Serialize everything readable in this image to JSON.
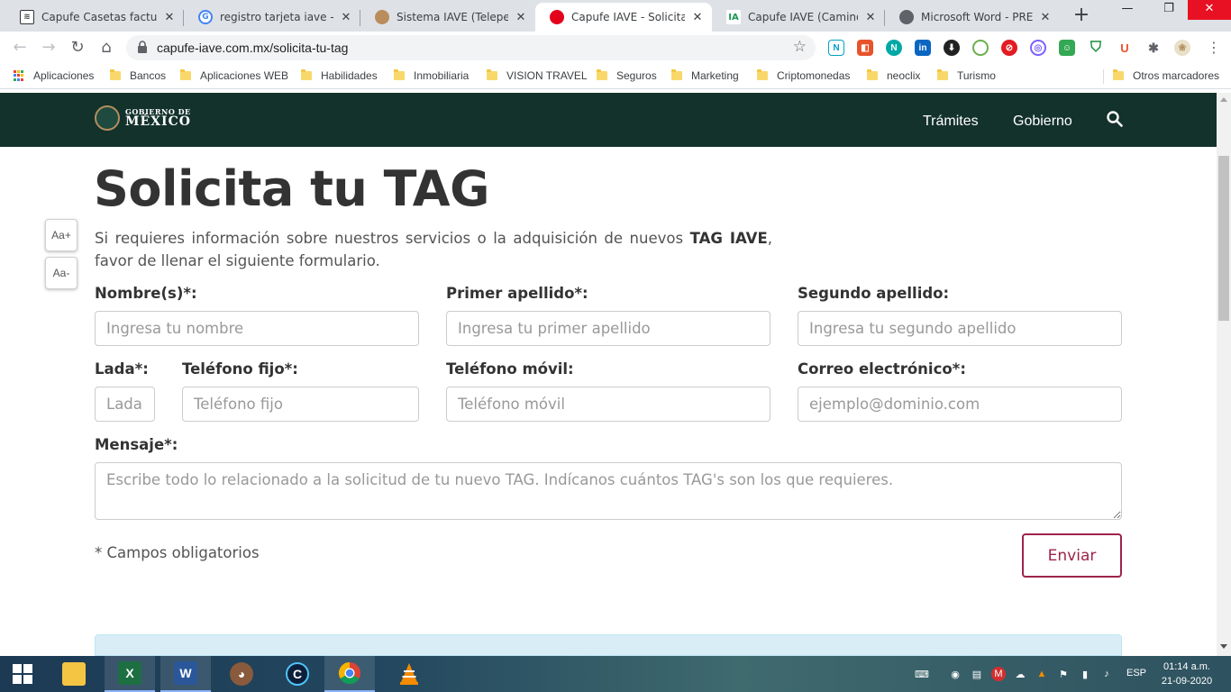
{
  "browser": {
    "tabs": [
      {
        "title": "Capufe Casetas factur",
        "favicon": "capufe-icon",
        "active": false
      },
      {
        "title": "registro tarjeta iave - Bus",
        "favicon": "google-icon",
        "active": false
      },
      {
        "title": "Sistema IAVE (Telepeaje)",
        "favicon": "iave-icon",
        "active": false
      },
      {
        "title": "Capufe IAVE - Solicita tu",
        "favicon": "capufe-red-icon",
        "active": true
      },
      {
        "title": "Capufe IAVE (Caminos y",
        "favicon": "iave-green-icon",
        "active": false
      },
      {
        "title": "Microsoft Word - PREGU",
        "favicon": "globe-icon",
        "active": false
      }
    ],
    "url": "capufe-iave.com.mx/solicita-tu-tag",
    "bookmarks": [
      {
        "label": "Aplicaciones",
        "type": "apps"
      },
      {
        "label": "Bancos",
        "type": "folder"
      },
      {
        "label": "Aplicaciones WEB",
        "type": "folder"
      },
      {
        "label": "Habilidades",
        "type": "folder"
      },
      {
        "label": "Inmobiliaria",
        "type": "folder"
      },
      {
        "label": "VISION TRAVEL",
        "type": "folder"
      },
      {
        "label": "Seguros",
        "type": "folder"
      },
      {
        "label": "Marketing",
        "type": "folder"
      },
      {
        "label": "Criptomonedas",
        "type": "folder"
      },
      {
        "label": "neoclix",
        "type": "folder"
      },
      {
        "label": "Turismo",
        "type": "folder"
      }
    ],
    "other_bookmarks": "Otros marcadores"
  },
  "header": {
    "logo_line1": "GOBIERNO DE",
    "logo_line2": "MÉXICO",
    "nav": [
      "Trámites",
      "Gobierno"
    ]
  },
  "accessibility": {
    "increase": "Aa+",
    "decrease": "Aa-"
  },
  "main": {
    "title": "Solicita tu TAG",
    "intro_before": "Si requieres información sobre nuestros servicios o la adquisición de nuevos ",
    "intro_bold": "TAG IAVE",
    "intro_after": ", favor de llenar el siguiente formulario."
  },
  "form": {
    "nombre": {
      "label": "Nombre(s)*:",
      "placeholder": "Ingresa tu nombre",
      "value": ""
    },
    "primer_apellido": {
      "label": "Primer apellido*:",
      "placeholder": "Ingresa tu primer apellido",
      "value": ""
    },
    "segundo_apellido": {
      "label": "Segundo apellido:",
      "placeholder": "Ingresa tu segundo apellido",
      "value": ""
    },
    "lada": {
      "label": "Lada*:",
      "placeholder": "Lada",
      "value": ""
    },
    "telefono_fijo": {
      "label": "Teléfono fijo*:",
      "placeholder": "Teléfono fijo",
      "value": ""
    },
    "telefono_movil": {
      "label": "Teléfono móvil:",
      "placeholder": "Teléfono móvil",
      "value": ""
    },
    "correo": {
      "label": "Correo electrónico*:",
      "placeholder": "ejemplo@dominio.com",
      "value": ""
    },
    "mensaje": {
      "label": "Mensaje*:",
      "placeholder": "Escribe todo lo relacionado a la solicitud de tu nuevo TAG. Indícanos cuántos TAG's son los que requieres.",
      "value": ""
    },
    "required_note": "* Campos obligatorios",
    "submit_label": "Enviar"
  },
  "taskbar": {
    "apps": [
      "excel-icon",
      "word-icon",
      "gimp-icon",
      "ccleaner-icon",
      "chrome-icon",
      "vlc-icon"
    ],
    "language": "ESP",
    "time": "01:14 a.m.",
    "date": "21-09-2020"
  },
  "colors": {
    "gov_green": "#13322b",
    "accent_maroon": "#9d2449",
    "info_blue": "#d9edf7"
  }
}
